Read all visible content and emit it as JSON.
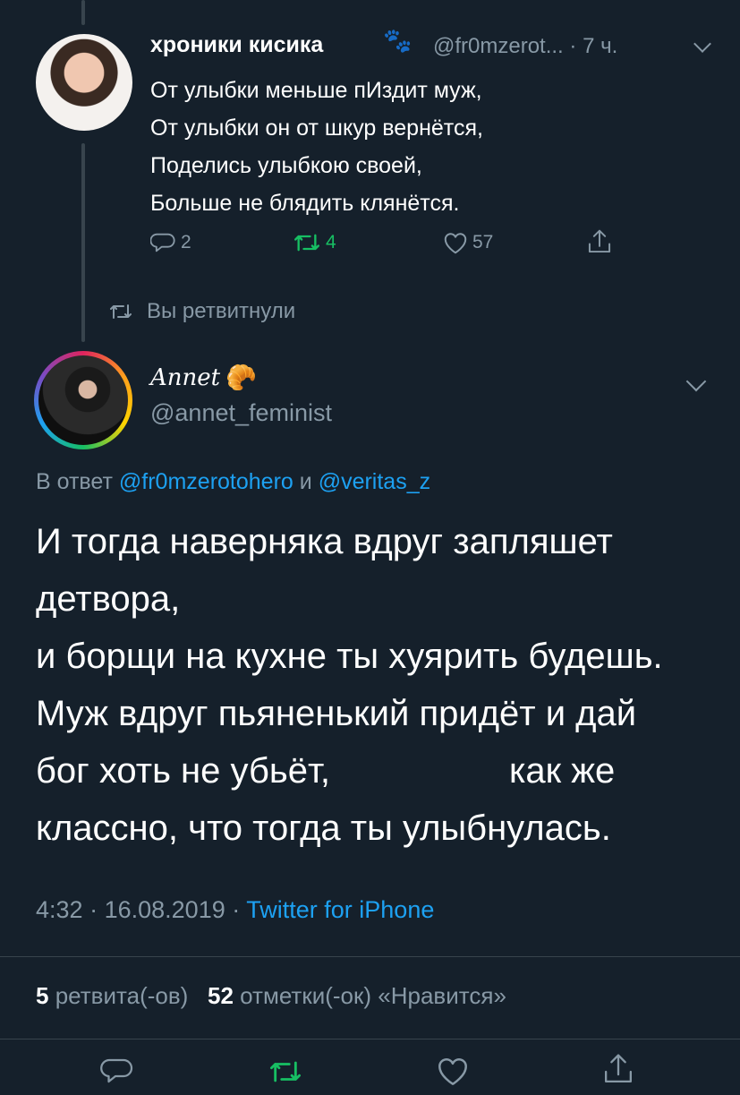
{
  "quoted_tweet": {
    "display_name": "хроники кисика",
    "handle": "@fr0mzerot...",
    "dot": "·",
    "time": "7 ч.",
    "lines": [
      "От улыбки меньше пИздит муж,",
      "От улыбки он от шкур вернётся,",
      "Поделись улыбкою своей,",
      "Больше не блядить клянётся."
    ],
    "replies": "2",
    "retweets": "4",
    "likes": "57"
  },
  "retweet_note": "Вы ретвитнули",
  "main_tweet": {
    "display_name": "Annet",
    "handle": "@annet_feminist",
    "reply_prefix": "В ответ",
    "reply_to_1": "@fr0mzerotohero",
    "reply_and": "и",
    "reply_to_2": "@veritas_z",
    "lines": [
      "И тогда наверняка вдруг запляшет",
      "детвора,",
      "и борщи на кухне ты хуярить будешь.",
      "Муж вдруг пьяненький придёт и дай",
      "бог хоть не убьёт,                  как же",
      "классно, что тогда ты улыбнулась."
    ],
    "time": "4:32",
    "date": "16.08.2019",
    "source": "Twitter for iPhone",
    "retweet_count": "5",
    "retweet_label": "ретвита(-ов)",
    "like_count": "52",
    "like_label": "отметки(-ок) «Нравится»"
  },
  "colors": {
    "background": "#15202b",
    "secondary_text": "#8899a6",
    "link": "#1da1f2",
    "retweet_green": "#17bf63",
    "divider": "#38444d"
  },
  "icons": {
    "reply": "reply-icon",
    "retweet": "retweet-icon",
    "like": "heart-icon",
    "share": "share-icon",
    "paw": "paw-icon",
    "croissant": "croissant-icon"
  }
}
